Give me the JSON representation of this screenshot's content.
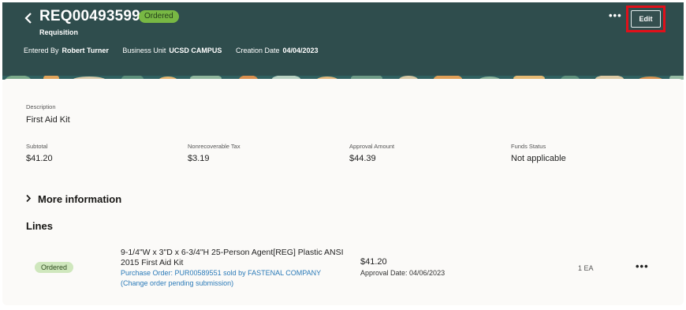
{
  "header": {
    "title": "REQ00493599",
    "status": "Ordered",
    "subtitle": "Requisition",
    "entered_by_label": "Entered By",
    "entered_by_value": "Robert Turner",
    "business_unit_label": "Business Unit",
    "business_unit_value": "UCSD CAMPUS",
    "creation_date_label": "Creation Date",
    "creation_date_value": "04/04/2023",
    "more_icon": "more-horizontal-icon",
    "edit_label": "Edit",
    "highlight_color": "#e0101a",
    "background_color": "#2f4d4d"
  },
  "details": {
    "description_label": "Description",
    "description_value": "First Aid Kit",
    "subtotal_label": "Subtotal",
    "subtotal_value": "$41.20",
    "tax_label": "Nonrecoverable Tax",
    "tax_value": "$3.19",
    "approval_amount_label": "Approval Amount",
    "approval_amount_value": "$44.39",
    "funds_status_label": "Funds Status",
    "funds_status_value": "Not applicable"
  },
  "more_information": {
    "label": "More information",
    "icon": "chevron-right-icon"
  },
  "lines": {
    "title": "Lines",
    "items": [
      {
        "status": "Ordered",
        "description": "9-1/4\"W x 3\"D x 6-3/4\"H 25-Person Agent[REG] Plastic ANSI 2015 First Aid Kit",
        "po_link": "Purchase Order: PUR00589551 sold by FASTENAL COMPANY (Change order pending submission)",
        "amount": "$41.20",
        "approval_date": "Approval Date: 04/06/2023",
        "quantity": "1 EA"
      }
    ]
  }
}
